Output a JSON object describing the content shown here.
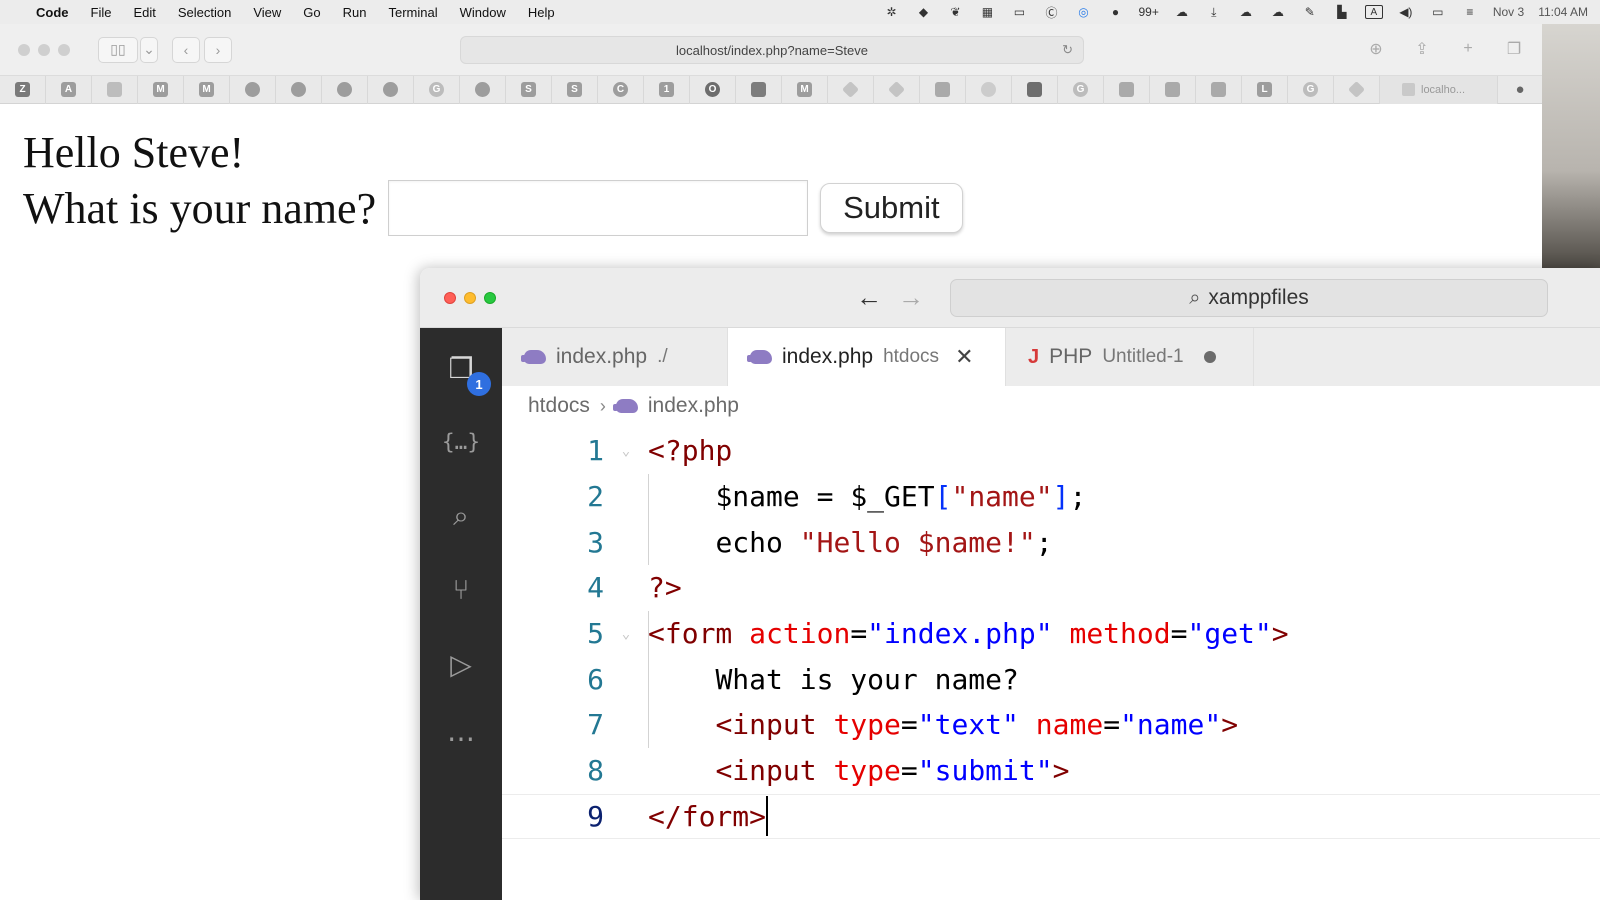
{
  "menubar": {
    "app_name": "Code",
    "items": [
      "File",
      "Edit",
      "Selection",
      "View",
      "Go",
      "Run",
      "Terminal",
      "Window",
      "Help"
    ],
    "notifications_count": "99+",
    "date": "Nov 3",
    "time": "11:04 AM",
    "status_icons": [
      "bug-icon",
      "dropbox-icon",
      "evernote-icon",
      "grid-icon",
      "window-icon",
      "c-icon",
      "activity-icon",
      "wechat-icon",
      "cloud-icon",
      "download-icon",
      "cloud-x-icon",
      "cloud-x2-icon",
      "pen-icon",
      "tray-icon",
      "keyboard-icon",
      "volume-icon",
      "battery-icon",
      "control-center-icon"
    ]
  },
  "safari": {
    "url": "localhost/index.php?name=Steve",
    "favorites": [
      "Z",
      "A",
      "",
      "M",
      "M",
      "",
      "",
      "",
      "",
      "G",
      "",
      "S",
      "S",
      "C",
      "1",
      "O",
      "",
      "M",
      "",
      "",
      "",
      "",
      "",
      "G",
      "",
      "",
      "",
      "L",
      "G",
      ""
    ],
    "open_tab_label": "localho..."
  },
  "page": {
    "greeting": "Hello Steve!",
    "question": "What is your name?",
    "input_value": "",
    "submit_label": "Submit"
  },
  "vscode": {
    "search_label": "xamppfiles",
    "explorer_badge": "1",
    "tabs": [
      {
        "label": "index.php",
        "description": "./"
      },
      {
        "label": "index.php",
        "description": "htdocs"
      },
      {
        "label": "PHP",
        "description": "Untitled-1"
      }
    ],
    "breadcrumb": {
      "folder": "htdocs",
      "file": "index.php"
    },
    "line_numbers": [
      "1",
      "2",
      "3",
      "4",
      "5",
      "6",
      "7",
      "8",
      "9"
    ],
    "code": {
      "l1": "<?php",
      "l2_indent": "    ",
      "l2_var": "$name",
      "l2_eq": " = ",
      "l2_get": "$_GET",
      "l2_open": "[",
      "l2_key": "\"name\"",
      "l2_close": "]",
      "l2_semi": ";",
      "l3_indent": "    ",
      "l3_echo": "echo ",
      "l3_str": "\"Hello $name!\"",
      "l3_semi": ";",
      "l4": "?>",
      "l5_open": "<form",
      "l5_sp1": " ",
      "l5_attr1": "action",
      "l5_eq1": "=",
      "l5_val1": "\"index.php\"",
      "l5_sp2": " ",
      "l5_attr2": "method",
      "l5_eq2": "=",
      "l5_val2": "\"get\"",
      "l5_close": ">",
      "l6_indent": "    ",
      "l6_text": "What is your name?",
      "l7_indent": "    ",
      "l7_tag": "<input",
      "l7_sp1": " ",
      "l7_attr1": "type",
      "l7_eq1": "=",
      "l7_val1": "\"text\"",
      "l7_sp2": " ",
      "l7_attr2": "name",
      "l7_eq2": "=",
      "l7_val2": "\"name\"",
      "l7_close": ">",
      "l8_indent": "    ",
      "l8_tag": "<input",
      "l8_sp1": " ",
      "l8_attr1": "type",
      "l8_eq1": "=",
      "l8_val1": "\"submit\"",
      "l8_close": ">",
      "l9": "</form>"
    }
  }
}
